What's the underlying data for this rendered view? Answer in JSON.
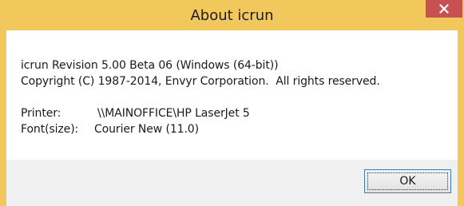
{
  "window": {
    "title": "About icrun",
    "frame_color": "#f2c75c",
    "close_color": "#c75050",
    "close_icon": "close-icon"
  },
  "content": {
    "revision_line": "icrun Revision 5.00 Beta 06 (Windows (64-bit))",
    "copyright_line": "Copyright (C) 1987-2014, Envyr Corporation.  All rights reserved.",
    "printer_label": "Printer:",
    "printer_value": "\\\\MAINOFFICE\\HP LaserJet 5",
    "font_label": "Font(size):",
    "font_value": "Courier New (11.0)"
  },
  "footer": {
    "ok_label": "OK"
  }
}
